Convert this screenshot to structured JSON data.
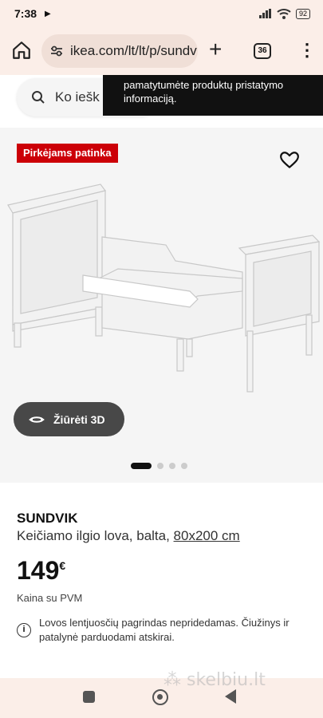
{
  "status_bar": {
    "time": "7:38",
    "battery": "92"
  },
  "browser": {
    "url": "ikea.com/lt/lt/p/sundv",
    "tabs_count": "36"
  },
  "search": {
    "placeholder": "Ko iešk"
  },
  "tooltip": {
    "text": "pamatytumėte produktų pristatymo informaciją."
  },
  "product": {
    "badge": "Pirkėjams patinka",
    "view_3d_label": "Žiūrėti 3D",
    "name": "SUNDVIK",
    "description": "Keičiamo ilgio lova, balta, ",
    "size": "80x200 cm",
    "price": "149",
    "currency": "€",
    "vat_note": "Kaina su PVM",
    "info": "Lovos lentjuosčių pagrindas nepridedamas. Čiužinys ir patalynė parduodami atskirai.",
    "image_count": 4,
    "active_image": 1
  },
  "watermark": "skelbiu.lt",
  "colors": {
    "badge": "#cc0008",
    "chrome_bg": "#fbeee8",
    "button_3d": "#484848"
  }
}
